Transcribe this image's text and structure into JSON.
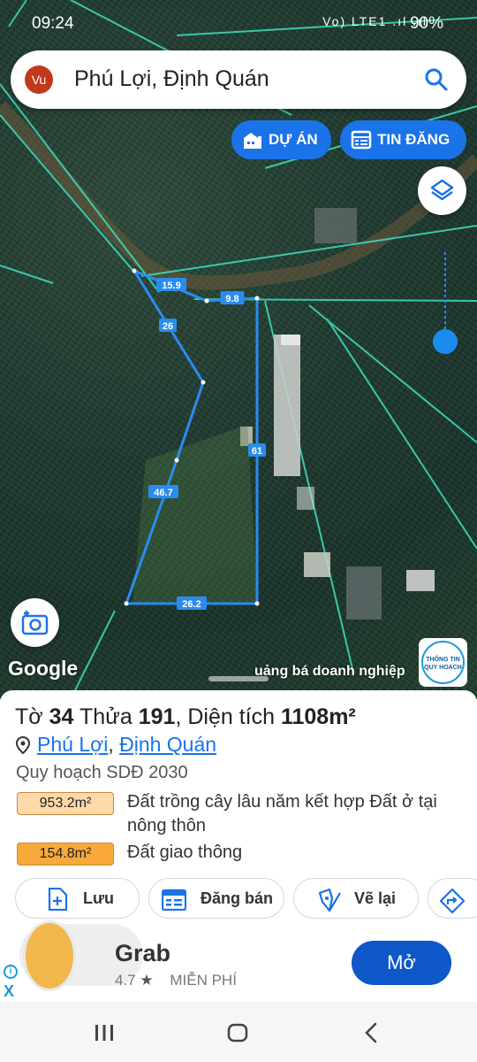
{
  "status_bar": {
    "time": "09:24",
    "icons": "Vo) LTE1 .ıl .ıl",
    "battery": "90%"
  },
  "search": {
    "avatar": "Vu",
    "query": "Phú Lợi, Định Quán"
  },
  "pills": {
    "duan": "DỰ ÁN",
    "tindang": "TIN ĐĂNG"
  },
  "map": {
    "edges": [
      "15.9",
      "9.8",
      "26",
      "61",
      "46.7",
      "26.2"
    ],
    "google_label": "Google",
    "ad_text": "uảng bá doanh nghiệp",
    "badge_text": "THÔNG TIN QUY HOẠCH"
  },
  "parcel": {
    "to_label": "Tờ",
    "to_value": "34",
    "thua_label": "Thửa",
    "thua_value": "191",
    "area_label": ", Diện tích",
    "area_value": "1108m²",
    "ward": "Phú Lợi",
    "district": "Định Quán",
    "plan_label": "Quy hoạch SDĐ 2030",
    "zones": [
      {
        "area": "953.2m²",
        "desc": "Đất trồng cây lâu năm kết hợp Đất ở tại nông thôn",
        "color": "#ffd9a8"
      },
      {
        "area": "154.8m²",
        "desc": "Đất giao thông",
        "color": "#f8a93a"
      }
    ]
  },
  "actions": {
    "save": "Lưu",
    "sell": "Đăng bán",
    "redraw": "Vẽ lại"
  },
  "ad": {
    "name": "Grab",
    "rating": "4.7",
    "price": "MIỄN PHÍ",
    "cta": "Mở",
    "info": "i",
    "close": "X"
  },
  "icons": [
    "search-icon",
    "building-icon",
    "list-icon",
    "layers-icon",
    "camera-icon",
    "location-pin-icon",
    "file-plus-icon",
    "calendar-icon",
    "pencil-icon",
    "route-icon"
  ],
  "colors": {
    "accent": "#1a73e8",
    "parcel_line": "#2a8cf0",
    "cta": "#0d57c8"
  }
}
